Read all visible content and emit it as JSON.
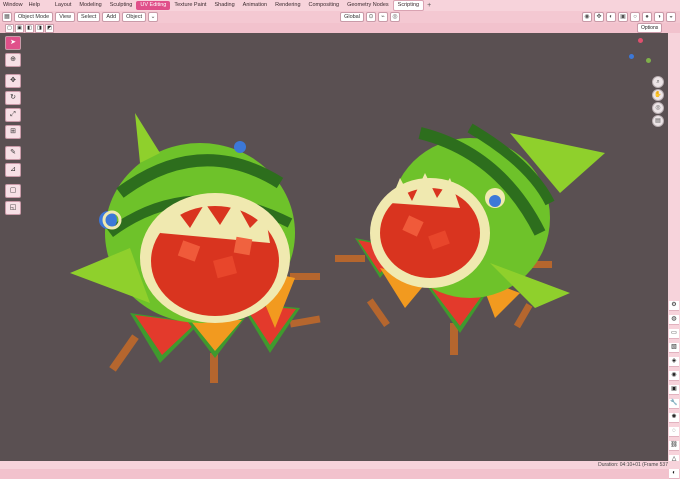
{
  "top_menu": {
    "items": [
      "Window",
      "Help"
    ],
    "workspaces": [
      "Layout",
      "Modeling",
      "Sculpting",
      "UV Editing",
      "Texture Paint",
      "Shading",
      "Animation",
      "Rendering",
      "Compositing",
      "Geometry Nodes",
      "Scripting"
    ],
    "active_workspace": "UV Editing",
    "add_workspace": "+"
  },
  "header": {
    "mode": "Object Mode",
    "menus": [
      "View",
      "Select",
      "Add",
      "Object"
    ],
    "transform_orientation": "Global",
    "options": "Options"
  },
  "toolbar": {
    "tools": [
      "select-box",
      "cursor",
      "move",
      "rotate",
      "scale",
      "transform",
      "annotate",
      "measure",
      "add-cube",
      "shear"
    ],
    "active": "select-box"
  },
  "gizmo": {
    "colors": {
      "x": "#e0506e",
      "y": "#7fb04a",
      "z": "#3c78d8"
    }
  },
  "status": {
    "text": "Duration: 04:10+01 (Frame 537"
  },
  "colors": {
    "accent": "#e0508a",
    "viewport": "#5a5052",
    "chrome": "#f7d3db"
  }
}
